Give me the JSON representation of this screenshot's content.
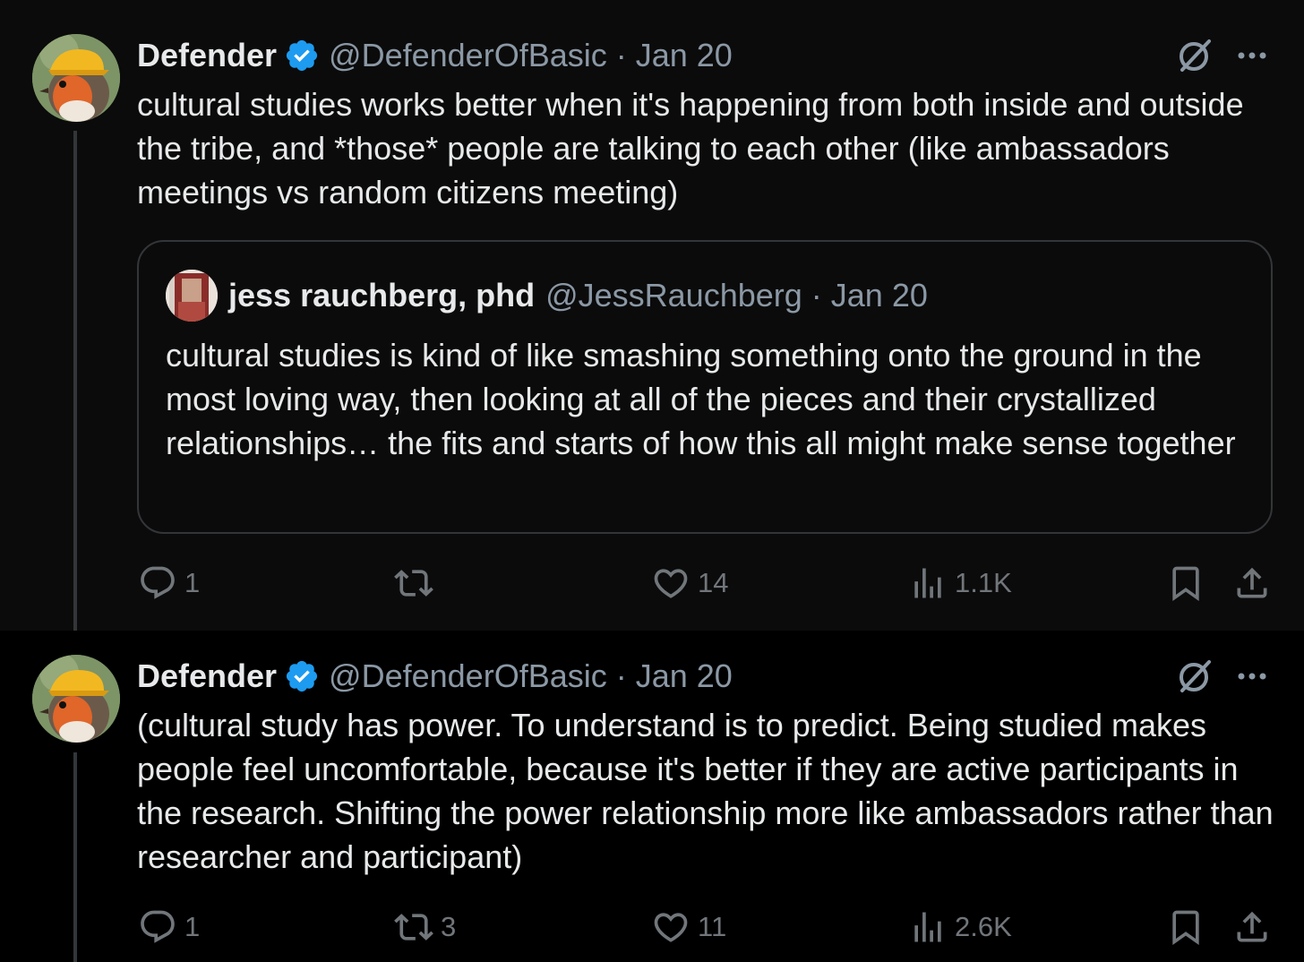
{
  "tweets": [
    {
      "author_name": "Defender",
      "handle": "@DefenderOfBasic",
      "separator": "·",
      "date": "Jan 20",
      "text": "cultural studies works better when it's happening from both inside and outside the tribe, and *those* people are talking to each other (like ambassadors meetings vs random citizens meeting)",
      "quote": {
        "author_name": "jess rauchberg, phd",
        "handle": "@JessRauchberg",
        "separator": "·",
        "date": "Jan 20",
        "text": "cultural studies is kind of like smashing something onto the ground in the most loving way, then looking at all of the pieces and their crystallized relationships… the fits and starts of how this all might make sense together"
      },
      "actions": {
        "replies": "1",
        "reposts": "",
        "likes": "14",
        "views": "1.1K"
      }
    },
    {
      "author_name": "Defender",
      "handle": "@DefenderOfBasic",
      "separator": "·",
      "date": "Jan 20",
      "text": "(cultural study has power. To understand is to predict. Being studied makes people feel uncomfortable, because it's better if they are active participants in the research. Shifting the power relationship more like ambassadors rather than researcher and participant)",
      "actions": {
        "replies": "1",
        "reposts": "3",
        "likes": "11",
        "views": "2.6K"
      }
    }
  ],
  "colors": {
    "background": "#000000",
    "text_primary": "#e7e9ea",
    "text_secondary": "#8b98a5",
    "icon_gray": "#71767b",
    "verified_blue": "#1d9bf0",
    "border": "#333639"
  },
  "icons": [
    "verified-badge-icon",
    "grok-icon",
    "more-icon",
    "reply-icon",
    "repost-icon",
    "like-icon",
    "views-icon",
    "bookmark-icon",
    "share-icon"
  ]
}
